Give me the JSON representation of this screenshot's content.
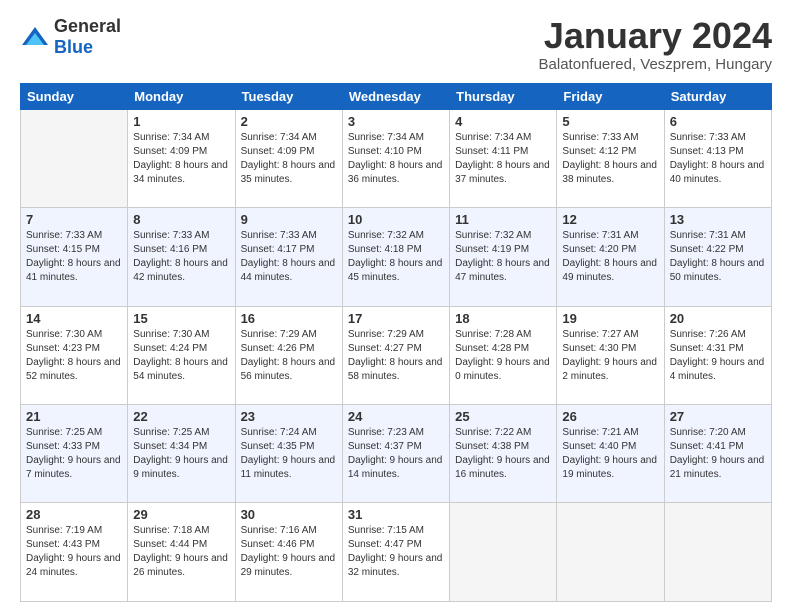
{
  "logo": {
    "general": "General",
    "blue": "Blue"
  },
  "header": {
    "title": "January 2024",
    "subtitle": "Balatonfuered, Veszprem, Hungary"
  },
  "weekdays": [
    "Sunday",
    "Monday",
    "Tuesday",
    "Wednesday",
    "Thursday",
    "Friday",
    "Saturday"
  ],
  "weeks": [
    [
      {
        "day": "",
        "sunrise": "",
        "sunset": "",
        "daylight": ""
      },
      {
        "day": "1",
        "sunrise": "Sunrise: 7:34 AM",
        "sunset": "Sunset: 4:09 PM",
        "daylight": "Daylight: 8 hours and 34 minutes."
      },
      {
        "day": "2",
        "sunrise": "Sunrise: 7:34 AM",
        "sunset": "Sunset: 4:09 PM",
        "daylight": "Daylight: 8 hours and 35 minutes."
      },
      {
        "day": "3",
        "sunrise": "Sunrise: 7:34 AM",
        "sunset": "Sunset: 4:10 PM",
        "daylight": "Daylight: 8 hours and 36 minutes."
      },
      {
        "day": "4",
        "sunrise": "Sunrise: 7:34 AM",
        "sunset": "Sunset: 4:11 PM",
        "daylight": "Daylight: 8 hours and 37 minutes."
      },
      {
        "day": "5",
        "sunrise": "Sunrise: 7:33 AM",
        "sunset": "Sunset: 4:12 PM",
        "daylight": "Daylight: 8 hours and 38 minutes."
      },
      {
        "day": "6",
        "sunrise": "Sunrise: 7:33 AM",
        "sunset": "Sunset: 4:13 PM",
        "daylight": "Daylight: 8 hours and 40 minutes."
      }
    ],
    [
      {
        "day": "7",
        "sunrise": "Sunrise: 7:33 AM",
        "sunset": "Sunset: 4:15 PM",
        "daylight": "Daylight: 8 hours and 41 minutes."
      },
      {
        "day": "8",
        "sunrise": "Sunrise: 7:33 AM",
        "sunset": "Sunset: 4:16 PM",
        "daylight": "Daylight: 8 hours and 42 minutes."
      },
      {
        "day": "9",
        "sunrise": "Sunrise: 7:33 AM",
        "sunset": "Sunset: 4:17 PM",
        "daylight": "Daylight: 8 hours and 44 minutes."
      },
      {
        "day": "10",
        "sunrise": "Sunrise: 7:32 AM",
        "sunset": "Sunset: 4:18 PM",
        "daylight": "Daylight: 8 hours and 45 minutes."
      },
      {
        "day": "11",
        "sunrise": "Sunrise: 7:32 AM",
        "sunset": "Sunset: 4:19 PM",
        "daylight": "Daylight: 8 hours and 47 minutes."
      },
      {
        "day": "12",
        "sunrise": "Sunrise: 7:31 AM",
        "sunset": "Sunset: 4:20 PM",
        "daylight": "Daylight: 8 hours and 49 minutes."
      },
      {
        "day": "13",
        "sunrise": "Sunrise: 7:31 AM",
        "sunset": "Sunset: 4:22 PM",
        "daylight": "Daylight: 8 hours and 50 minutes."
      }
    ],
    [
      {
        "day": "14",
        "sunrise": "Sunrise: 7:30 AM",
        "sunset": "Sunset: 4:23 PM",
        "daylight": "Daylight: 8 hours and 52 minutes."
      },
      {
        "day": "15",
        "sunrise": "Sunrise: 7:30 AM",
        "sunset": "Sunset: 4:24 PM",
        "daylight": "Daylight: 8 hours and 54 minutes."
      },
      {
        "day": "16",
        "sunrise": "Sunrise: 7:29 AM",
        "sunset": "Sunset: 4:26 PM",
        "daylight": "Daylight: 8 hours and 56 minutes."
      },
      {
        "day": "17",
        "sunrise": "Sunrise: 7:29 AM",
        "sunset": "Sunset: 4:27 PM",
        "daylight": "Daylight: 8 hours and 58 minutes."
      },
      {
        "day": "18",
        "sunrise": "Sunrise: 7:28 AM",
        "sunset": "Sunset: 4:28 PM",
        "daylight": "Daylight: 9 hours and 0 minutes."
      },
      {
        "day": "19",
        "sunrise": "Sunrise: 7:27 AM",
        "sunset": "Sunset: 4:30 PM",
        "daylight": "Daylight: 9 hours and 2 minutes."
      },
      {
        "day": "20",
        "sunrise": "Sunrise: 7:26 AM",
        "sunset": "Sunset: 4:31 PM",
        "daylight": "Daylight: 9 hours and 4 minutes."
      }
    ],
    [
      {
        "day": "21",
        "sunrise": "Sunrise: 7:25 AM",
        "sunset": "Sunset: 4:33 PM",
        "daylight": "Daylight: 9 hours and 7 minutes."
      },
      {
        "day": "22",
        "sunrise": "Sunrise: 7:25 AM",
        "sunset": "Sunset: 4:34 PM",
        "daylight": "Daylight: 9 hours and 9 minutes."
      },
      {
        "day": "23",
        "sunrise": "Sunrise: 7:24 AM",
        "sunset": "Sunset: 4:35 PM",
        "daylight": "Daylight: 9 hours and 11 minutes."
      },
      {
        "day": "24",
        "sunrise": "Sunrise: 7:23 AM",
        "sunset": "Sunset: 4:37 PM",
        "daylight": "Daylight: 9 hours and 14 minutes."
      },
      {
        "day": "25",
        "sunrise": "Sunrise: 7:22 AM",
        "sunset": "Sunset: 4:38 PM",
        "daylight": "Daylight: 9 hours and 16 minutes."
      },
      {
        "day": "26",
        "sunrise": "Sunrise: 7:21 AM",
        "sunset": "Sunset: 4:40 PM",
        "daylight": "Daylight: 9 hours and 19 minutes."
      },
      {
        "day": "27",
        "sunrise": "Sunrise: 7:20 AM",
        "sunset": "Sunset: 4:41 PM",
        "daylight": "Daylight: 9 hours and 21 minutes."
      }
    ],
    [
      {
        "day": "28",
        "sunrise": "Sunrise: 7:19 AM",
        "sunset": "Sunset: 4:43 PM",
        "daylight": "Daylight: 9 hours and 24 minutes."
      },
      {
        "day": "29",
        "sunrise": "Sunrise: 7:18 AM",
        "sunset": "Sunset: 4:44 PM",
        "daylight": "Daylight: 9 hours and 26 minutes."
      },
      {
        "day": "30",
        "sunrise": "Sunrise: 7:16 AM",
        "sunset": "Sunset: 4:46 PM",
        "daylight": "Daylight: 9 hours and 29 minutes."
      },
      {
        "day": "31",
        "sunrise": "Sunrise: 7:15 AM",
        "sunset": "Sunset: 4:47 PM",
        "daylight": "Daylight: 9 hours and 32 minutes."
      },
      {
        "day": "",
        "sunrise": "",
        "sunset": "",
        "daylight": ""
      },
      {
        "day": "",
        "sunrise": "",
        "sunset": "",
        "daylight": ""
      },
      {
        "day": "",
        "sunrise": "",
        "sunset": "",
        "daylight": ""
      }
    ]
  ]
}
